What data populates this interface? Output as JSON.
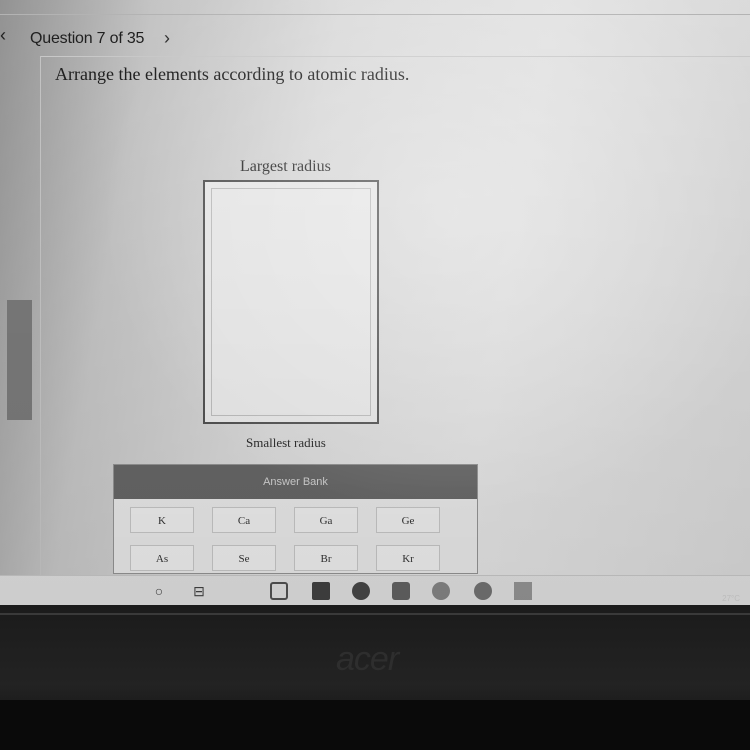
{
  "header": {
    "back_glyph": "‹",
    "question_counter": "Question 7 of 35",
    "next_glyph": "›"
  },
  "question": {
    "prompt": "Arrange the elements according to atomic radius.",
    "top_label": "Largest radius",
    "bottom_label": "Smallest radius"
  },
  "answer_bank": {
    "title": "Answer Bank",
    "tiles": [
      "K",
      "Ca",
      "Ga",
      "Ge",
      "As",
      "Se",
      "Br",
      "Kr"
    ]
  },
  "taskbar": {
    "icons": [
      "windows-start-icon",
      "task-view-icon",
      "widgets-icon",
      "file-icon",
      "store-icon",
      "chrome-icon",
      "mail-icon",
      "browser-icon",
      "app-icon",
      "folder-icon"
    ],
    "temperature": "27°C"
  },
  "bezel": {
    "brand": "acer"
  }
}
